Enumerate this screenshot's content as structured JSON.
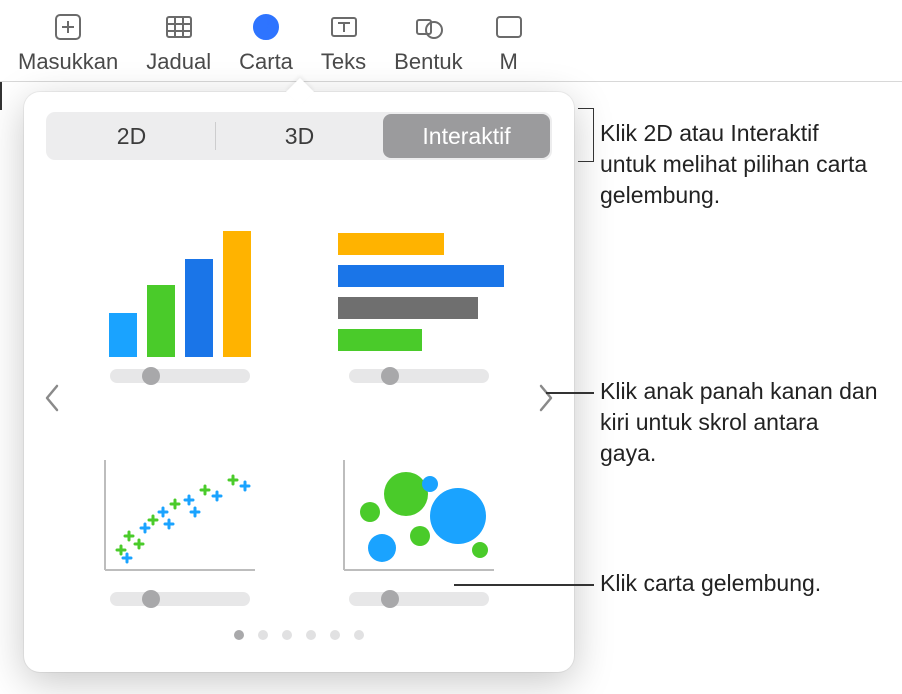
{
  "toolbar": {
    "insert": "Masukkan",
    "table": "Jadual",
    "chart": "Carta",
    "text": "Teks",
    "shape": "Bentuk",
    "media": "M"
  },
  "popover": {
    "tabs": {
      "t2d": "2D",
      "t3d": "3D",
      "interactive": "Interaktif"
    },
    "charts": {
      "column": "interactive-column-chart",
      "bar": "interactive-bar-chart",
      "scatter": "interactive-scatter-chart",
      "bubble": "interactive-bubble-chart"
    },
    "page_count": 6,
    "current_page": 1
  },
  "callouts": {
    "tabs": "Klik 2D atau Interaktif untuk melihat pilihan carta gelembung.",
    "arrows": "Klik anak panah kanan dan kiri untuk skrol antara gaya.",
    "bubble": "Klik carta gelembung."
  }
}
